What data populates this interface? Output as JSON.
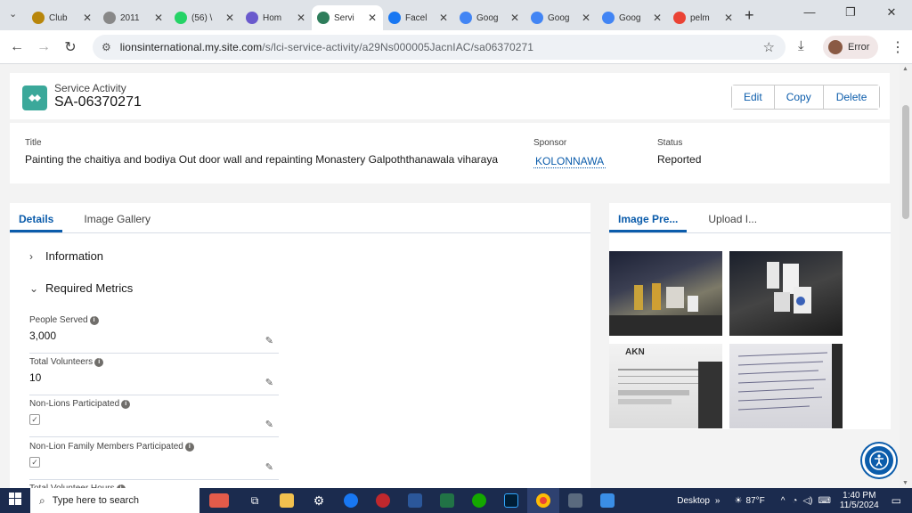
{
  "browser": {
    "tabs": [
      {
        "title": "Club",
        "icon": "lions-icon",
        "color": "#b8860b",
        "active": false
      },
      {
        "title": "2011",
        "icon": "globe-icon",
        "color": "#888888",
        "active": false
      },
      {
        "title": "(56) \\",
        "icon": "whatsapp-icon",
        "color": "#25d366",
        "active": false
      },
      {
        "title": "Hom",
        "icon": "lions-icon",
        "color": "#6a5acd",
        "active": false
      },
      {
        "title": "Servi",
        "icon": "lions-icon",
        "color": "#2e7d5b",
        "active": true
      },
      {
        "title": "Facel",
        "icon": "facebook-icon",
        "color": "#1877f2",
        "active": false
      },
      {
        "title": "Goog",
        "icon": "google-translate-icon",
        "color": "#4285f4",
        "active": false
      },
      {
        "title": "Goog",
        "icon": "google-translate-icon",
        "color": "#4285f4",
        "active": false
      },
      {
        "title": "Goog",
        "icon": "google-translate-icon",
        "color": "#4285f4",
        "active": false
      },
      {
        "title": "pelm",
        "icon": "google-icon",
        "color": "#ea4335",
        "active": false
      }
    ],
    "url_host": "lionsinternational.my.site.com",
    "url_path": "/s/lci-service-activity/a29Ns000005JacnIAC/sa06370271",
    "profile_label": "Error"
  },
  "record": {
    "type_label": "Service Activity",
    "name": "SA-06370271",
    "actions": [
      "Edit",
      "Copy",
      "Delete"
    ]
  },
  "highlights": {
    "title_label": "Title",
    "title_value": "Painting the chaitiya and bodiya Out door wall and repainting Monastery Galpoththanawala viharaya",
    "sponsor_label": "Sponsor",
    "sponsor_value": "KOLONNAWA",
    "status_label": "Status",
    "status_value": "Reported"
  },
  "left_tabs": [
    "Details",
    "Image Gallery"
  ],
  "sections": {
    "information": "Information",
    "required_metrics": "Required Metrics"
  },
  "metrics": [
    {
      "label": "People Served",
      "value": "3,000",
      "kind": "text"
    },
    {
      "label": "Total Volunteers",
      "value": "10",
      "kind": "text"
    },
    {
      "label": "Non-Lions Participated",
      "value": "",
      "kind": "checkbox"
    },
    {
      "label": "Non-Lion Family Members Participated",
      "value": "",
      "kind": "checkbox"
    },
    {
      "label": "Total Volunteer Hours",
      "value": "",
      "kind": "text"
    }
  ],
  "right_tabs": [
    "Image Pre...",
    "Upload I..."
  ],
  "taskbar": {
    "search_placeholder": "Type here to search",
    "desktop_label": "Desktop",
    "weather": "87°F",
    "time": "1:40 PM",
    "date": "11/5/2024"
  },
  "colors": {
    "brand_blue": "#0b5cab",
    "record_icon": "#3ba89a",
    "taskbar": "#1b2b4e"
  }
}
